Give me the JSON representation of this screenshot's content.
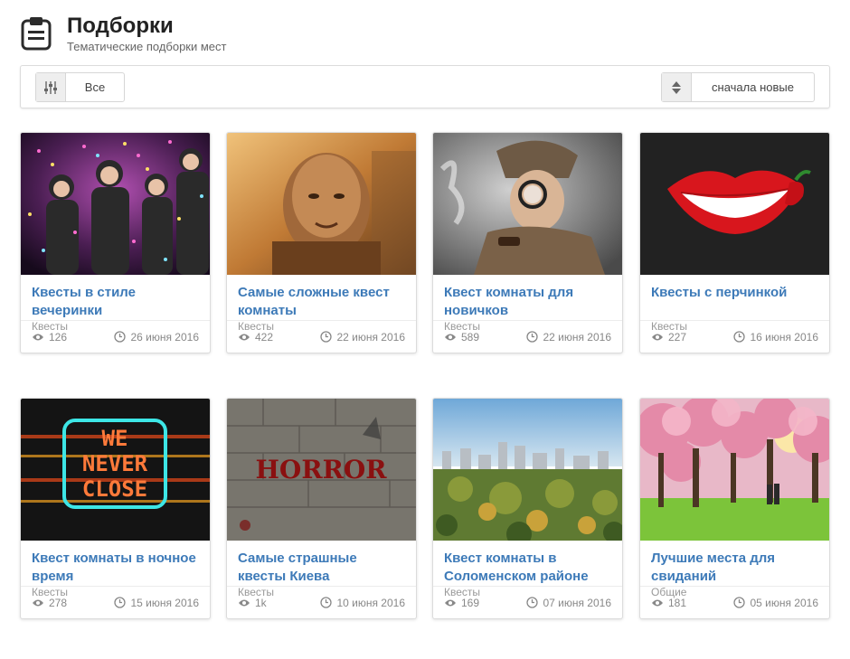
{
  "header": {
    "title": "Подборки",
    "subtitle": "Тематические подборки мест",
    "icon": "clipboard-icon"
  },
  "toolbar": {
    "filter_label": "Все",
    "filter_icon": "sliders-icon",
    "sort_label": "сначала новые",
    "sort_icon": "sort-arrows-icon"
  },
  "cards": [
    {
      "title": "Квесты в стиле вечеринки",
      "category": "Квесты",
      "views": "126",
      "date": "26 июня 2016"
    },
    {
      "title": "Самые сложные квест комнаты",
      "category": "Квесты",
      "views": "422",
      "date": "22 июня 2016"
    },
    {
      "title": "Квест комнаты для новичков",
      "category": "Квесты",
      "views": "589",
      "date": "22 июня 2016"
    },
    {
      "title": "Квесты с перчинкой",
      "category": "Квесты",
      "views": "227",
      "date": "16 июня 2016"
    },
    {
      "title": "Квест комнаты в ночное время",
      "category": "Квесты",
      "views": "278",
      "date": "15 июня 2016"
    },
    {
      "title": "Самые страшные квесты Киева",
      "category": "Квесты",
      "views": "1k",
      "date": "10 июня 2016"
    },
    {
      "title": "Квест комнаты в Соломенском районе",
      "category": "Квесты",
      "views": "169",
      "date": "07 июня 2016"
    },
    {
      "title": "Лучшие места для свиданий",
      "category": "Общие",
      "views": "181",
      "date": "05 июня 2016"
    }
  ],
  "image_text": {
    "neon_line1": "WE",
    "neon_line2": "NEVER",
    "neon_line3": "CLOSE",
    "horror": "HORROR"
  },
  "colors": {
    "title_link": "#3d7ab8",
    "meta_text": "#888888"
  }
}
